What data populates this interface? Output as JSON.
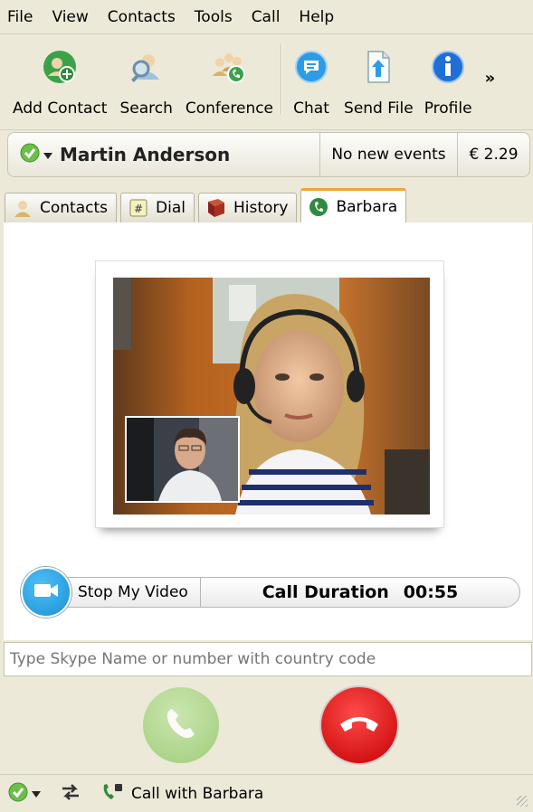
{
  "menu": {
    "items": [
      "File",
      "View",
      "Contacts",
      "Tools",
      "Call",
      "Help"
    ]
  },
  "toolbar": {
    "add_contact": "Add Contact",
    "search": "Search",
    "conference": "Conference",
    "chat": "Chat",
    "send_file": "Send File",
    "profile": "Profile",
    "more": "»"
  },
  "status": {
    "user_name": "Martin Anderson",
    "events": "No new events",
    "credit": "€ 2.29"
  },
  "tabs": {
    "contacts": "Contacts",
    "dial": "Dial",
    "history": "History",
    "active": "Barbara"
  },
  "call": {
    "stop_video": "Stop My Video",
    "duration_label": "Call Duration",
    "duration_value": "00:55"
  },
  "entry": {
    "placeholder": "Type Skype Name or number with country code"
  },
  "bottom": {
    "call_with": "Call with Barbara"
  },
  "colors": {
    "accent_orange": "#f2a33a",
    "call_green": "#92c96a",
    "hangup_red": "#c40000",
    "video_blue": "#1a8fd6",
    "status_green": "#6cc04a"
  }
}
